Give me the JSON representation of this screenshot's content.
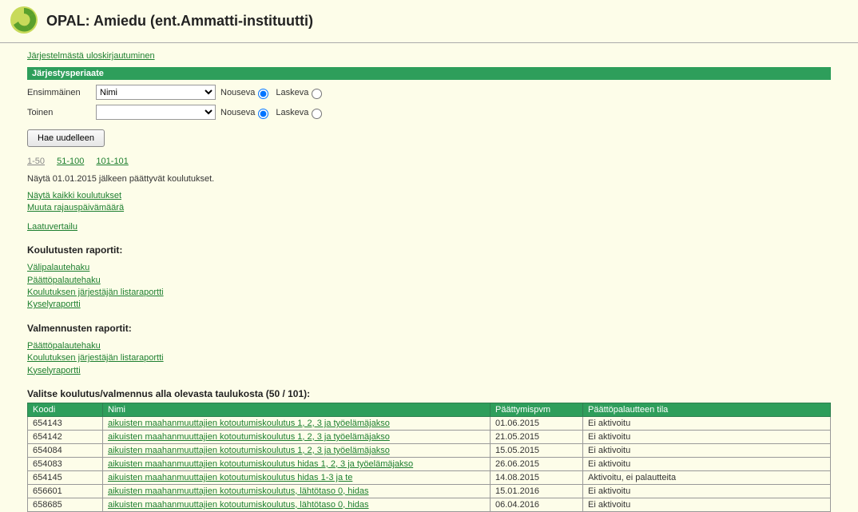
{
  "header": {
    "title": "OPAL: Amiedu (ent.Ammatti-instituutti)"
  },
  "logout_link": "Järjestelmästä uloskirjautuminen",
  "sort_section_title": "Järjestysperiaate",
  "sort": {
    "first_label": "Ensimmäinen",
    "first_value": "Nimi",
    "second_label": "Toinen",
    "second_value": "",
    "asc": "Nouseva",
    "desc": "Laskeva"
  },
  "search_button": "Hae uudelleen",
  "pager": {
    "p1": "1-50",
    "p2": "51-100",
    "p3": "101-101"
  },
  "info_text": "Näytä 01.01.2015 jälkeen päättyvät koulutukset.",
  "links1": {
    "all": "Näytä kaikki koulutukset",
    "change_date": "Muuta rajauspäivämäärä",
    "quality": "Laatuvertailu"
  },
  "reports1_title": "Koulutusten raportit:",
  "reports1": {
    "a": "Välipalautehaku",
    "b": "Päättöpalautehaku",
    "c": "Koulutuksen järjestäjän listaraportti",
    "d": "Kyselyraportti"
  },
  "reports2_title": "Valmennusten raportit:",
  "reports2": {
    "a": "Päättöpalautehaku",
    "b": "Koulutuksen järjestäjän listaraportti",
    "c": "Kyselyraportti"
  },
  "table_title": "Valitse koulutus/valmennus alla olevasta taulukosta (50 / 101):",
  "columns": {
    "koodi": "Koodi",
    "nimi": "Nimi",
    "paatty": "Päättymispvm",
    "tila": "Päättöpalautteen tila"
  },
  "rows": [
    {
      "koodi": "654143",
      "nimi": "aikuisten maahanmuuttajien kotoutumiskoulutus 1, 2, 3 ja työelämäjakso",
      "paatty": "01.06.2015",
      "tila": "Ei aktivoitu"
    },
    {
      "koodi": "654142",
      "nimi": "aikuisten maahanmuuttajien kotoutumiskoulutus 1, 2, 3 ja työelämäjakso",
      "paatty": "21.05.2015",
      "tila": "Ei aktivoitu"
    },
    {
      "koodi": "654084",
      "nimi": "aikuisten maahanmuuttajien kotoutumiskoulutus 1, 2, 3 ja työelämäjakso",
      "paatty": "15.05.2015",
      "tila": "Ei aktivoitu"
    },
    {
      "koodi": "654083",
      "nimi": "aikuisten maahanmuuttajien kotoutumiskoulutus hidas 1, 2, 3 ja työelämäjakso",
      "paatty": "26.06.2015",
      "tila": "Ei aktivoitu"
    },
    {
      "koodi": "654145",
      "nimi": "aikuisten maahanmuuttajien kotoutumiskoulutus hidas 1-3 ja te",
      "paatty": "14.08.2015",
      "tila": "Aktivoitu, ei palautteita"
    },
    {
      "koodi": "656601",
      "nimi": "aikuisten maahanmuuttajien kotoutumiskoulutus, lähtötaso 0, hidas",
      "paatty": "15.01.2016",
      "tila": "Ei aktivoitu"
    },
    {
      "koodi": "658685",
      "nimi": "aikuisten maahanmuuttajien kotoutumiskoulutus, lähtötaso 0, hidas",
      "paatty": "06.04.2016",
      "tila": "Ei aktivoitu"
    }
  ]
}
